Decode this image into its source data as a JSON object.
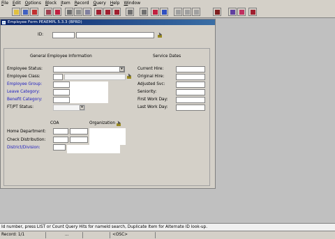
{
  "menu": [
    "File",
    "Edit",
    "Options",
    "Block",
    "Item",
    "Record",
    "Query",
    "Help",
    "Window"
  ],
  "toolbar_icons": [
    "save-icon",
    "rollback-icon",
    "exit-icon",
    "insert-record-icon",
    "remove-record-icon",
    "print-icon",
    "search-icon",
    "previous-block-icon",
    "next-block-icon",
    "previous-record-icon",
    "next-record-icon",
    "enter-query-icon",
    "execute-query-icon",
    "list-icon",
    "chart-icon",
    "report-icon",
    "help-icon",
    "attachments-icon",
    "tools-icon",
    "exit-form-icon"
  ],
  "window": {
    "title": "Employee Form  PEAEMPL  5.3.3  (BPRD)"
  },
  "id_label": "ID:",
  "general": {
    "header": "General Employee Information",
    "labels": [
      "Employee Status:",
      "Employee Class:",
      "Employee Group:",
      "Leave Category:",
      "Benefit Category:",
      "FT/PT Status:"
    ],
    "label_colors": [
      "#000000",
      "#000000",
      "#2020c0",
      "#2020c0",
      "#2020c0",
      "#000000"
    ]
  },
  "service": {
    "header": "Service Dates",
    "labels": [
      "Current Hire:",
      "Original Hire:",
      "Adjusted Svc:",
      "Seniority:",
      "First Work Day:",
      "Last Work Day:"
    ]
  },
  "org": {
    "coa_label": "COA",
    "org_label": "Organization",
    "labels": [
      "Home Department:",
      "Check Distribution:",
      "District/Division:"
    ]
  },
  "status": {
    "message": "Id number, press LIST or Count Query Hits for nameId search, Duplicate Item for Alternate ID look-up.",
    "record": "Record: 1/1",
    "dots": "...",
    "osc": "<OSC>"
  }
}
